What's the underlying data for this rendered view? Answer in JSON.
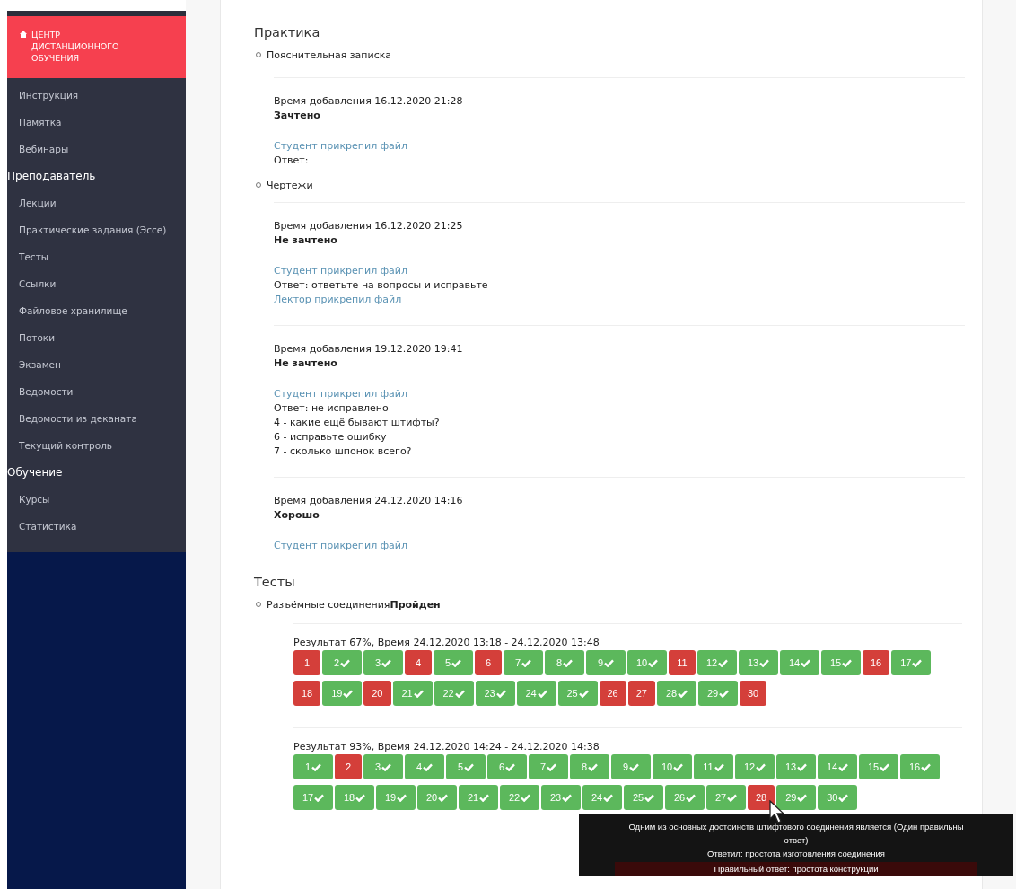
{
  "sidebar": {
    "brand": "ЦЕНТР ДИСТАНЦИОННОГО ОБУЧЕНИЯ",
    "entries": [
      {
        "kind": "item",
        "label": "Инструкция"
      },
      {
        "kind": "item",
        "label": "Памятка"
      },
      {
        "kind": "item",
        "label": "Вебинары"
      },
      {
        "kind": "section",
        "label": "Преподаватель"
      },
      {
        "kind": "item",
        "label": "Лекции"
      },
      {
        "kind": "item",
        "label": "Практические задания (Эссе)"
      },
      {
        "kind": "item",
        "label": "Тесты"
      },
      {
        "kind": "item",
        "label": "Ссылки"
      },
      {
        "kind": "item",
        "label": "Файловое хранилище"
      },
      {
        "kind": "item",
        "label": "Потоки"
      },
      {
        "kind": "item",
        "label": "Экзамен"
      },
      {
        "kind": "item",
        "label": "Ведомости"
      },
      {
        "kind": "item",
        "label": "Ведомости из деканата"
      },
      {
        "kind": "item",
        "label": "Текущий контроль"
      },
      {
        "kind": "section",
        "label": "Обучение"
      },
      {
        "kind": "item",
        "label": "Курсы"
      },
      {
        "kind": "item",
        "label": "Статистика"
      }
    ]
  },
  "practice": {
    "title": "Практика",
    "tasks": [
      {
        "title": "Пояснительная записка",
        "submissions": [
          {
            "time": "Время добавления 16.12.2020 21:28",
            "status": "Зачтено",
            "lines": [
              {
                "kind": "link",
                "text": "Студент прикрепил файл"
              },
              {
                "kind": "text",
                "text": "Ответ:"
              }
            ]
          }
        ]
      },
      {
        "title": "Чертежи",
        "submissions": [
          {
            "time": "Время добавления 16.12.2020 21:25",
            "status": "Не зачтено",
            "lines": [
              {
                "kind": "link",
                "text": "Студент прикрепил файл"
              },
              {
                "kind": "text",
                "text": "Ответ: ответьте на вопросы и исправьте"
              },
              {
                "kind": "link",
                "text": "Лектор прикрепил файл"
              }
            ]
          },
          {
            "time": "Время добавления 19.12.2020 19:41",
            "status": "Не зачтено",
            "lines": [
              {
                "kind": "link",
                "text": "Студент прикрепил файл"
              },
              {
                "kind": "text",
                "text": "Ответ: не исправлено"
              },
              {
                "kind": "text",
                "text": "4 - какие ещё бывают штифты?"
              },
              {
                "kind": "text",
                "text": "6 - исправьте ошибку"
              },
              {
                "kind": "text",
                "text": "7 - сколько шпонок всего?"
              }
            ]
          },
          {
            "time": "Время добавления 24.12.2020 14:16",
            "status": "Хорошо",
            "lines": [
              {
                "kind": "link",
                "text": "Студент прикрепил файл"
              }
            ]
          }
        ]
      }
    ]
  },
  "tests": {
    "title": "Тесты",
    "items": [
      {
        "name": "Разъёмные соединения",
        "status": "Пройден",
        "attempts": [
          {
            "result": "Результат 67%, Время 24.12.2020 13:18 - 24.12.2020 13:48",
            "questions": [
              {
                "label": "1",
                "correct": false
              },
              {
                "label": "2",
                "correct": true
              },
              {
                "label": "3",
                "correct": true
              },
              {
                "label": "4",
                "correct": false
              },
              {
                "label": "5",
                "correct": true
              },
              {
                "label": "6",
                "correct": false
              },
              {
                "label": "7",
                "correct": true
              },
              {
                "label": "8",
                "correct": true
              },
              {
                "label": "9",
                "correct": true
              },
              {
                "label": "10",
                "correct": true
              },
              {
                "label": "11",
                "correct": false
              },
              {
                "label": "12",
                "correct": true
              },
              {
                "label": "13",
                "correct": true
              },
              {
                "label": "14",
                "correct": true
              },
              {
                "label": "15",
                "correct": true
              },
              {
                "label": "16",
                "correct": false
              },
              {
                "label": "17",
                "correct": true
              },
              {
                "label": "18",
                "correct": false
              },
              {
                "label": "19",
                "correct": true
              },
              {
                "label": "20",
                "correct": false
              },
              {
                "label": "21",
                "correct": true
              },
              {
                "label": "22",
                "correct": true
              },
              {
                "label": "23",
                "correct": true
              },
              {
                "label": "24",
                "correct": true
              },
              {
                "label": "25",
                "correct": true
              },
              {
                "label": "26",
                "correct": false
              },
              {
                "label": "27",
                "correct": false
              },
              {
                "label": "28",
                "correct": true
              },
              {
                "label": "29",
                "correct": true
              },
              {
                "label": "30",
                "correct": false
              }
            ]
          },
          {
            "result": "Результат 93%, Время 24.12.2020 14:24 - 24.12.2020 14:38",
            "questions": [
              {
                "label": "1",
                "correct": true
              },
              {
                "label": "2",
                "correct": false
              },
              {
                "label": "3",
                "correct": true
              },
              {
                "label": "4",
                "correct": true
              },
              {
                "label": "5",
                "correct": true
              },
              {
                "label": "6",
                "correct": true
              },
              {
                "label": "7",
                "correct": true
              },
              {
                "label": "8",
                "correct": true
              },
              {
                "label": "9",
                "correct": true
              },
              {
                "label": "10",
                "correct": true
              },
              {
                "label": "11",
                "correct": true
              },
              {
                "label": "12",
                "correct": true
              },
              {
                "label": "13",
                "correct": true
              },
              {
                "label": "14",
                "correct": true
              },
              {
                "label": "15",
                "correct": true
              },
              {
                "label": "16",
                "correct": true
              },
              {
                "label": "17",
                "correct": true
              },
              {
                "label": "18",
                "correct": true
              },
              {
                "label": "19",
                "correct": true
              },
              {
                "label": "20",
                "correct": true
              },
              {
                "label": "21",
                "correct": true
              },
              {
                "label": "22",
                "correct": true
              },
              {
                "label": "23",
                "correct": true
              },
              {
                "label": "24",
                "correct": true
              },
              {
                "label": "25",
                "correct": true
              },
              {
                "label": "26",
                "correct": true
              },
              {
                "label": "27",
                "correct": true
              },
              {
                "label": "28",
                "correct": false,
                "tooltip": {
                  "question": [
                    "Одним из основных достоинств штифтового соединения является (Один правильны",
                    "ответ)"
                  ],
                  "answered": "Ответил: простота изготовления соединения",
                  "right_answer": "Правильный ответ: простота конструкции"
                }
              },
              {
                "label": "29",
                "correct": true
              },
              {
                "label": "30",
                "correct": true
              }
            ]
          }
        ]
      }
    ]
  }
}
